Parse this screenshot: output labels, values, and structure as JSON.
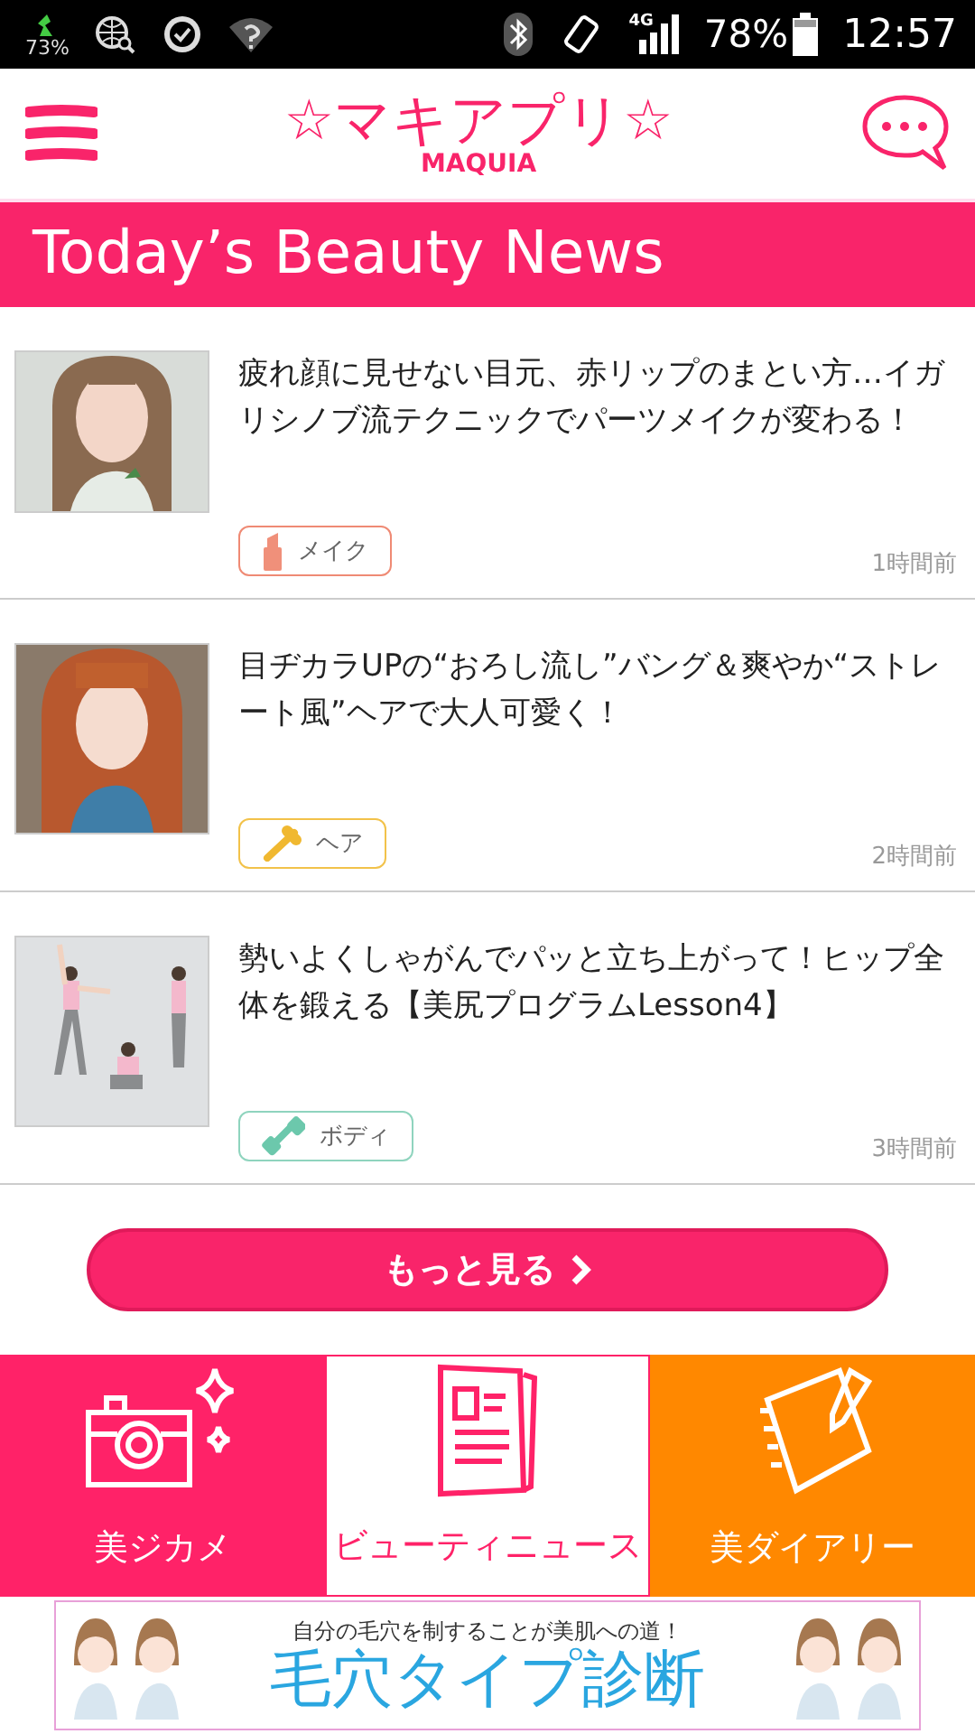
{
  "status_bar": {
    "data_saver": "73%",
    "network": "4G",
    "battery": "78%",
    "time": "12:57"
  },
  "header": {
    "logo": "☆マキアプリ☆",
    "logo_sub": "MAQUIA"
  },
  "section_title": "Today’s Beauty News",
  "news": [
    {
      "title": "疲れ顔に見せない目元、赤リップのまとい方…イガリシノブ流テクニックでパーツメイクが変わる！",
      "tag": {
        "label": "メイク",
        "kind": "makeup"
      },
      "time": "1時間前"
    },
    {
      "title": "目ヂカラUPの“おろし流し”バング＆爽やか“ストレート風”ヘアで大人可愛く！",
      "tag": {
        "label": "ヘア",
        "kind": "hair"
      },
      "time": "2時間前"
    },
    {
      "title": "勢いよくしゃがんでパッと立ち上がって！ヒップ全体を鍛える【美尻プログラムLesson4】",
      "tag": {
        "label": "ボディ",
        "kind": "body"
      },
      "time": "3時間前"
    }
  ],
  "more_button": "もっと見る",
  "nav_tiles": [
    {
      "label": "美ジカメ",
      "kind": "camera",
      "color": "#ff2268",
      "selected": false
    },
    {
      "label": "ビューティニュース",
      "kind": "news",
      "color": "#ff2268",
      "selected": true
    },
    {
      "label": "美ダイアリー",
      "kind": "diary",
      "color": "#ff8800",
      "selected": false
    }
  ],
  "banner": {
    "tagline": "自分の毛穴を制することが美肌への道！",
    "title": "毛穴タイプ診断"
  }
}
